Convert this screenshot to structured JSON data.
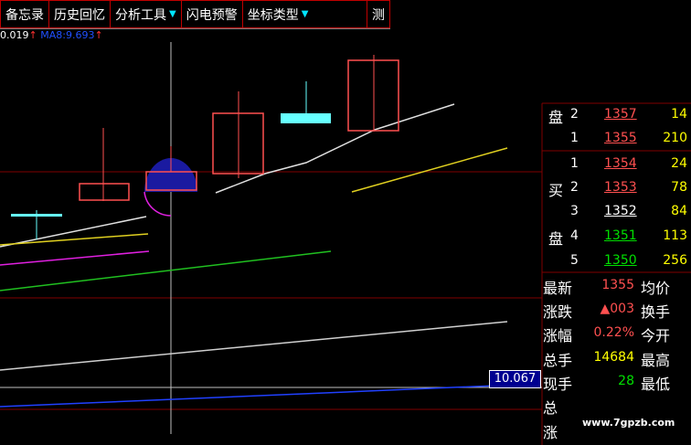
{
  "toolbar": {
    "items": [
      {
        "label": "备忘录"
      },
      {
        "label": "历史回忆"
      },
      {
        "label": "分析工具",
        "dropdown": true
      },
      {
        "label": "闪电预警"
      },
      {
        "label": "坐标类型",
        "dropdown": true
      },
      {
        "label": "测"
      }
    ]
  },
  "indicator": {
    "value1": "0.019",
    "arrow1": "↑",
    "ma_label": "MA8:",
    "ma_value": "9.693",
    "arrow2": "↑"
  },
  "order_book": {
    "rows": [
      {
        "side": "盘",
        "level": "2",
        "price": "1357",
        "volume": "14",
        "price_color": "red"
      },
      {
        "side": "",
        "level": "1",
        "price": "1355",
        "volume": "210",
        "price_color": "red"
      },
      {
        "side": "",
        "level": "1",
        "price": "1354",
        "volume": "24",
        "price_color": "red"
      },
      {
        "side": "买",
        "level": "2",
        "price": "1353",
        "volume": "78",
        "price_color": "red"
      },
      {
        "side": "",
        "level": "3",
        "price": "1352",
        "volume": "84",
        "price_color": "white"
      },
      {
        "side": "盘",
        "level": "4",
        "price": "1351",
        "volume": "113",
        "price_color": "green"
      },
      {
        "side": "",
        "level": "5",
        "price": "1350",
        "volume": "256",
        "price_color": "green"
      }
    ]
  },
  "stats": [
    {
      "label": "最新",
      "value": "1355",
      "color": "red",
      "label2": "均价"
    },
    {
      "label": "涨跌",
      "value": "▲003",
      "color": "red",
      "label2": "换手"
    },
    {
      "label": "涨幅",
      "value": "0.22%",
      "color": "red",
      "label2": "今开"
    },
    {
      "label": "总手",
      "value": "14684",
      "color": "yellow",
      "label2": "最高"
    },
    {
      "label": "现手",
      "value": "28",
      "color": "green",
      "label2": "最低"
    },
    {
      "label": "总",
      "value": "",
      "color": "white",
      "label2": ""
    },
    {
      "label": "涨",
      "value": "",
      "color": "white",
      "label2": ""
    }
  ],
  "badge": "10.067",
  "watermark": "www.7gpzb.com",
  "colors": {
    "up": "#ff5050",
    "down": "#00e000",
    "cyan": "#66ffff",
    "grid": "#800000"
  }
}
